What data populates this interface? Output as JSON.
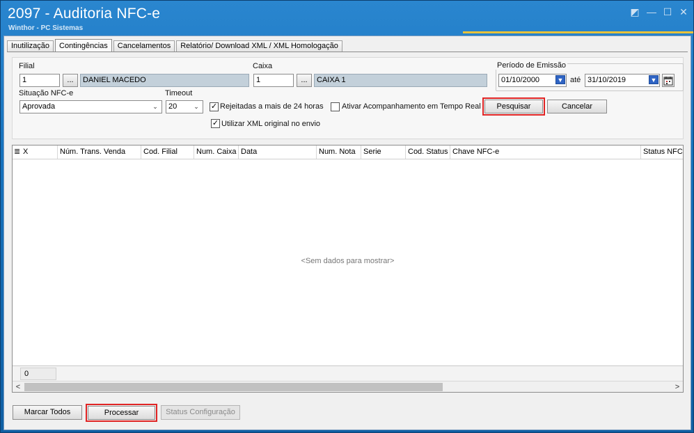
{
  "window": {
    "title": "2097 - Auditoria NFC-e",
    "subtitle": "Winthor - PC Sistemas",
    "controls": {
      "restore": "◩",
      "minimize": "—",
      "maximize": "☐",
      "close": "✕"
    }
  },
  "tabs": [
    {
      "label": "Inutilização",
      "active": false
    },
    {
      "label": "Contingências",
      "active": true
    },
    {
      "label": "Cancelamentos",
      "active": false
    },
    {
      "label": "Relatório/ Download XML / XML Homologação",
      "active": false
    }
  ],
  "filters": {
    "filial": {
      "label": "Filial",
      "code": "1",
      "lookup_button": "...",
      "name": "DANIEL MACEDO"
    },
    "caixa": {
      "label": "Caixa",
      "code": "1",
      "lookup_button": "...",
      "name": "CAIXA 1"
    },
    "periodo": {
      "label": "Período de Emissão",
      "start": "01/10/2000",
      "separator": "até",
      "end": "31/10/2019"
    },
    "situacao": {
      "label": "Situação NFC-e",
      "value": "Aprovada"
    },
    "timeout": {
      "label": "Timeout",
      "value": "20"
    },
    "rejeitadas": {
      "label": "Rejeitadas a mais de 24 horas",
      "checked": true,
      "mark": "✓"
    },
    "acompanhamento": {
      "label": "Ativar Acompanhamento em Tempo Real",
      "checked": false,
      "mark": ""
    },
    "xml_original": {
      "label": "Utilizar XML original no envio",
      "checked": true,
      "mark": "✓"
    },
    "pesquisar_button": "Pesquisar",
    "cancelar_button": "Cancelar"
  },
  "grid": {
    "columns": [
      "X",
      "Núm. Trans. Venda",
      "Cod. Filial",
      "Num. Caixa",
      "Data",
      "Num. Nota",
      "Serie",
      "Cod. Status",
      "Chave NFC-e",
      "Status NFC-e"
    ],
    "empty_message": "<Sem dados para mostrar>",
    "footer_count": "0",
    "menu_icon": "≣"
  },
  "actions": {
    "marcar_todos": "Marcar Todos",
    "processar": "Processar",
    "status_configuracao": "Status Configuração"
  },
  "colors": {
    "titlebar": "#1672bd",
    "highlight": "#e02424",
    "lookup_field": "#c3d0da",
    "dropdown_accent": "#2f64c4"
  }
}
